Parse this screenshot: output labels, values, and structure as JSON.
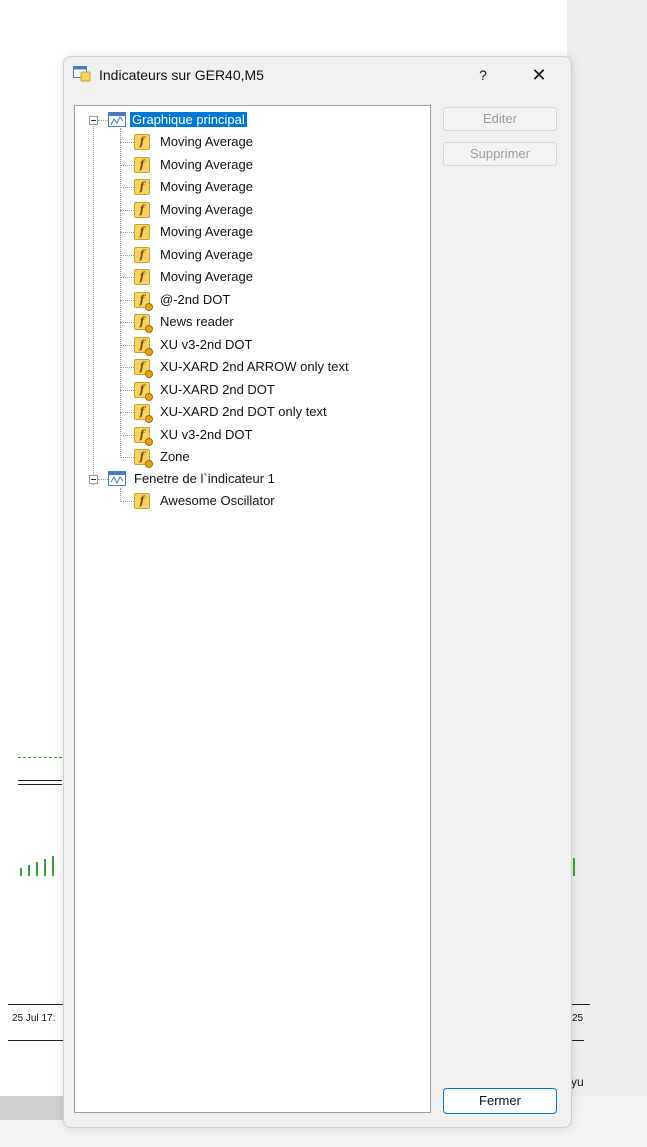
{
  "window": {
    "title": "Indicateurs sur GER40,M5",
    "help_label": "?",
    "close_label": "✕"
  },
  "tree": {
    "groups": [
      {
        "label": "Graphique principal",
        "selected": true,
        "items": [
          {
            "label": "Moving Average",
            "icon": "builtin-indicator-icon"
          },
          {
            "label": "Moving Average",
            "icon": "builtin-indicator-icon"
          },
          {
            "label": "Moving Average",
            "icon": "builtin-indicator-icon"
          },
          {
            "label": "Moving Average",
            "icon": "builtin-indicator-icon"
          },
          {
            "label": "Moving Average",
            "icon": "builtin-indicator-icon"
          },
          {
            "label": "Moving Average",
            "icon": "builtin-indicator-icon"
          },
          {
            "label": "Moving Average",
            "icon": "builtin-indicator-icon"
          },
          {
            "label": "@-2nd DOT",
            "icon": "custom-indicator-icon"
          },
          {
            "label": "News reader",
            "icon": "custom-indicator-icon"
          },
          {
            "label": "XU v3-2nd DOT",
            "icon": "custom-indicator-icon"
          },
          {
            "label": "XU-XARD 2nd ARROW only text",
            "icon": "custom-indicator-icon"
          },
          {
            "label": "XU-XARD 2nd DOT",
            "icon": "custom-indicator-icon"
          },
          {
            "label": "XU-XARD 2nd DOT only text",
            "icon": "custom-indicator-icon"
          },
          {
            "label": "XU v3-2nd DOT",
            "icon": "custom-indicator-icon"
          },
          {
            "label": "Zone",
            "icon": "custom-indicator-icon"
          }
        ]
      },
      {
        "label": "Fenetre de l`indicateur 1",
        "selected": false,
        "items": [
          {
            "label": "Awesome Oscillator",
            "icon": "builtin-indicator-icon"
          }
        ]
      }
    ]
  },
  "buttons": {
    "edit": "Editer",
    "delete": "Supprimer",
    "close": "Fermer"
  },
  "background": {
    "date_label_left": "25 Jul 17:",
    "date_label_right": "25",
    "right_fragment": "yu"
  },
  "colors": {
    "accent": "#0078d7",
    "indicator_bar": "#3aa13a"
  }
}
